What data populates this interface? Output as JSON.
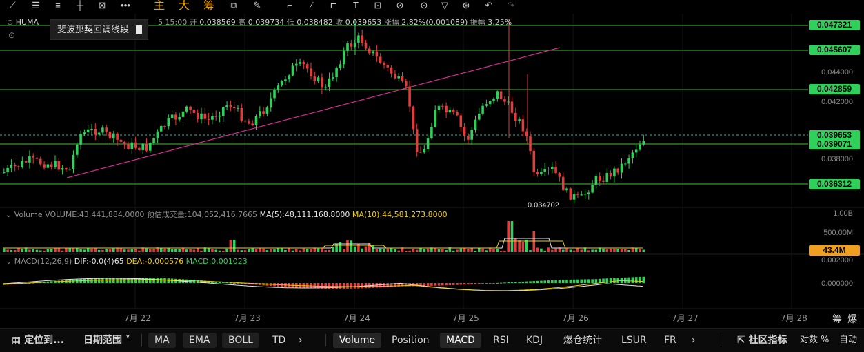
{
  "toolbar": {
    "icons": [
      "pencil-icon",
      "horizontal-lines-icon",
      "list-icon",
      "crosshair-icon",
      "ruler-icon",
      "more-icon"
    ],
    "main_label": "主",
    "big_label": "大",
    "chip_label": "筹"
  },
  "tooltip": {
    "text": "斐波那契回调线段"
  },
  "info_line": {
    "symbol": "HUMA",
    "time": "5 15:00",
    "open_label": "开",
    "open": "0.038569",
    "high_label": "高",
    "high": "0.039734",
    "low_label": "低",
    "low": "0.038482",
    "close_label": "收",
    "close": "0.039653",
    "change_label": "涨幅",
    "change": "2.82%(0.001089)",
    "amp_label": "振幅",
    "amp": "3.25%"
  },
  "price_axis": [
    "0.044000",
    "0.042000",
    "0.038000"
  ],
  "price_tags": [
    "0.047321",
    "0.045607",
    "0.042859",
    "0.039653",
    "0.039071",
    "0.036312"
  ],
  "low_marker": "0.034702",
  "volume_panel": {
    "title": "Volume",
    "volume": "VOLUME:43,441,884.0000",
    "estimated": "预估成交量:104,052,416.7665",
    "ma5": "MA(5):48,111,168.8000",
    "ma10": "MA(10):44,581,273.8000",
    "axis": [
      "1.00B",
      "500.00M"
    ],
    "current_tag": "43.4M"
  },
  "macd_panel": {
    "title": "MACD(12,26,9)",
    "dif": "DIF:-0.0(4)65",
    "dea": "DEA:-0.000576",
    "macd": "MACD:0.001023",
    "axis": [
      "0.002000",
      "0.000000"
    ]
  },
  "dates": [
    "7月 22",
    "7月 23",
    "7月 24",
    "7月 25",
    "7月 26",
    "7月 27",
    "7月 28"
  ],
  "corner_labels": [
    "筹",
    "爆"
  ],
  "bottom_bar": {
    "locate": "定位到...",
    "range": "日期范围",
    "indicators_main": [
      "MA",
      "EMA",
      "BOLL",
      "TD"
    ],
    "indicators_sub": [
      "Volume",
      "Position",
      "MACD",
      "RSI",
      "KDJ",
      "爆仓统计",
      "LSUR",
      "FR"
    ],
    "community": "社区指标",
    "log": "对数",
    "percent": "%",
    "auto": "自动"
  },
  "colors": {
    "up": "#2fd15a",
    "down": "#e23c3c",
    "trend": "#d0308f",
    "level": "#3fbf2f"
  }
}
